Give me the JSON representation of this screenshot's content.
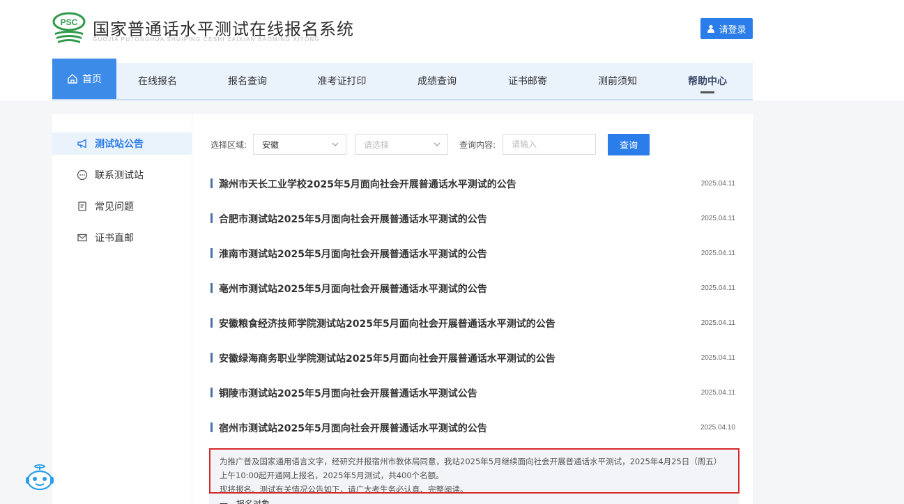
{
  "header": {
    "logo_badge": "PSC",
    "title": "国家普通话水平测试在线报名系统",
    "subtitle": "GUOJIA PUTONGHUA SHUIPING CESHI ZAIXIAN BAOMING XITONG",
    "login_label": "请登录"
  },
  "nav": {
    "items": [
      {
        "label": "首页"
      },
      {
        "label": "在线报名"
      },
      {
        "label": "报名查询"
      },
      {
        "label": "准考证打印"
      },
      {
        "label": "成绩查询"
      },
      {
        "label": "证书邮寄"
      },
      {
        "label": "测前须知"
      },
      {
        "label": "帮助中心"
      }
    ]
  },
  "sidebar": {
    "items": [
      {
        "label": "测试站公告",
        "icon": "megaphone-icon"
      },
      {
        "label": "联系测试站",
        "icon": "chat-icon"
      },
      {
        "label": "常见问题",
        "icon": "document-icon"
      },
      {
        "label": "证书直邮",
        "icon": "mail-icon"
      }
    ]
  },
  "filter": {
    "region_label": "选择区域:",
    "province_value": "安徽",
    "city_placeholder": "请选择",
    "content_label": "查询内容:",
    "content_placeholder": "请输入",
    "query_label": "查询"
  },
  "notices": [
    {
      "title": "滁州市天长工业学校2025年5月面向社会开展普通话水平测试的公告",
      "date": "2025.04.11"
    },
    {
      "title": "合肥市测试站2025年5月面向社会开展普通话水平测试的公告",
      "date": "2025.04.11"
    },
    {
      "title": "淮南市测试站2025年5月面向社会开展普通话水平测试的公告",
      "date": "2025.04.11"
    },
    {
      "title": "亳州市测试站2025年5月面向社会开展普通话水平测试的公告",
      "date": "2025.04.11"
    },
    {
      "title": "安徽粮食经济技师学院测试站2025年5月面向社会开展普通话水平测试的公告",
      "date": "2025.04.11"
    },
    {
      "title": "安徽绿海商务职业学院测试站2025年5月面向社会开展普通话水平测试的公告",
      "date": "2025.04.11"
    },
    {
      "title": "铜陵市测试站2025年5月面向社会开展普通话水平测试公告",
      "date": "2025.04.11"
    },
    {
      "title": "宿州市测试站2025年5月面向社会开展普通话水平测试的公告",
      "date": "2025.04.10"
    }
  ],
  "detail": {
    "lines": [
      "为推广普及国家通用语言文字，经研究并报宿州市教体局同意，我站2025年5月继续面向社会开展普通话水平测试，2025年4月25日（周五）",
      "上午10:00起开通网上报名，2025年5月测试，共400个名额。",
      "现将报名、测试有关情况公告如下，请广大考生务必认真、完整阅读。"
    ],
    "section": "一、报名对象"
  },
  "colors": {
    "primary": "#2b7de9",
    "nav_bg": "#eaf2fc",
    "highlight": "#d42a2a"
  }
}
